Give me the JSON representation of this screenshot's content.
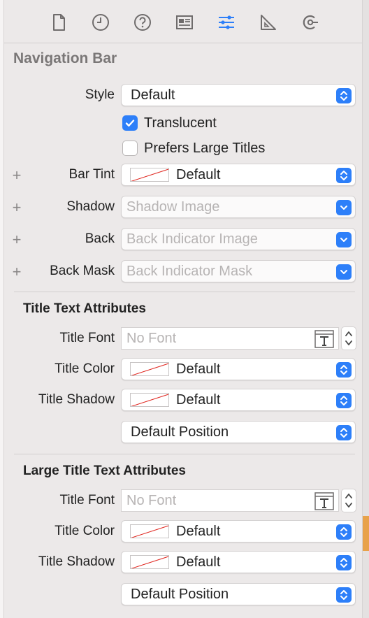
{
  "colors": {
    "accent": "#2d7ff9",
    "swatch_line": "#e0261f"
  },
  "tabs": [
    {
      "icon": "file-icon"
    },
    {
      "icon": "clock-icon"
    },
    {
      "icon": "help-icon"
    },
    {
      "icon": "identity-icon"
    },
    {
      "icon": "attributes-icon"
    },
    {
      "icon": "size-icon"
    },
    {
      "icon": "connections-icon"
    }
  ],
  "section_title": "Navigation Bar",
  "style": {
    "label": "Style",
    "value": "Default"
  },
  "translucent": {
    "label": "Translucent",
    "checked": true
  },
  "prefers_large_titles": {
    "label": "Prefers Large Titles",
    "checked": false
  },
  "bar_tint": {
    "label": "Bar Tint",
    "value": "Default"
  },
  "shadow": {
    "label": "Shadow",
    "placeholder": "Shadow Image"
  },
  "back": {
    "label": "Back",
    "placeholder": "Back Indicator Image"
  },
  "back_mask": {
    "label": "Back Mask",
    "placeholder": "Back Indicator Mask"
  },
  "plus_symbol": "+",
  "title_text_attributes": {
    "heading": "Title Text Attributes",
    "font_label": "Title Font",
    "font_placeholder": "No Font",
    "color_label": "Title Color",
    "color_value": "Default",
    "shadow_label": "Title Shadow",
    "shadow_value": "Default",
    "position_value": "Default Position"
  },
  "large_title_text_attributes": {
    "heading": "Large Title Text Attributes",
    "font_label": "Title Font",
    "font_placeholder": "No Font",
    "color_label": "Title Color",
    "color_value": "Default",
    "shadow_label": "Title Shadow",
    "shadow_value": "Default",
    "position_value": "Default Position"
  }
}
